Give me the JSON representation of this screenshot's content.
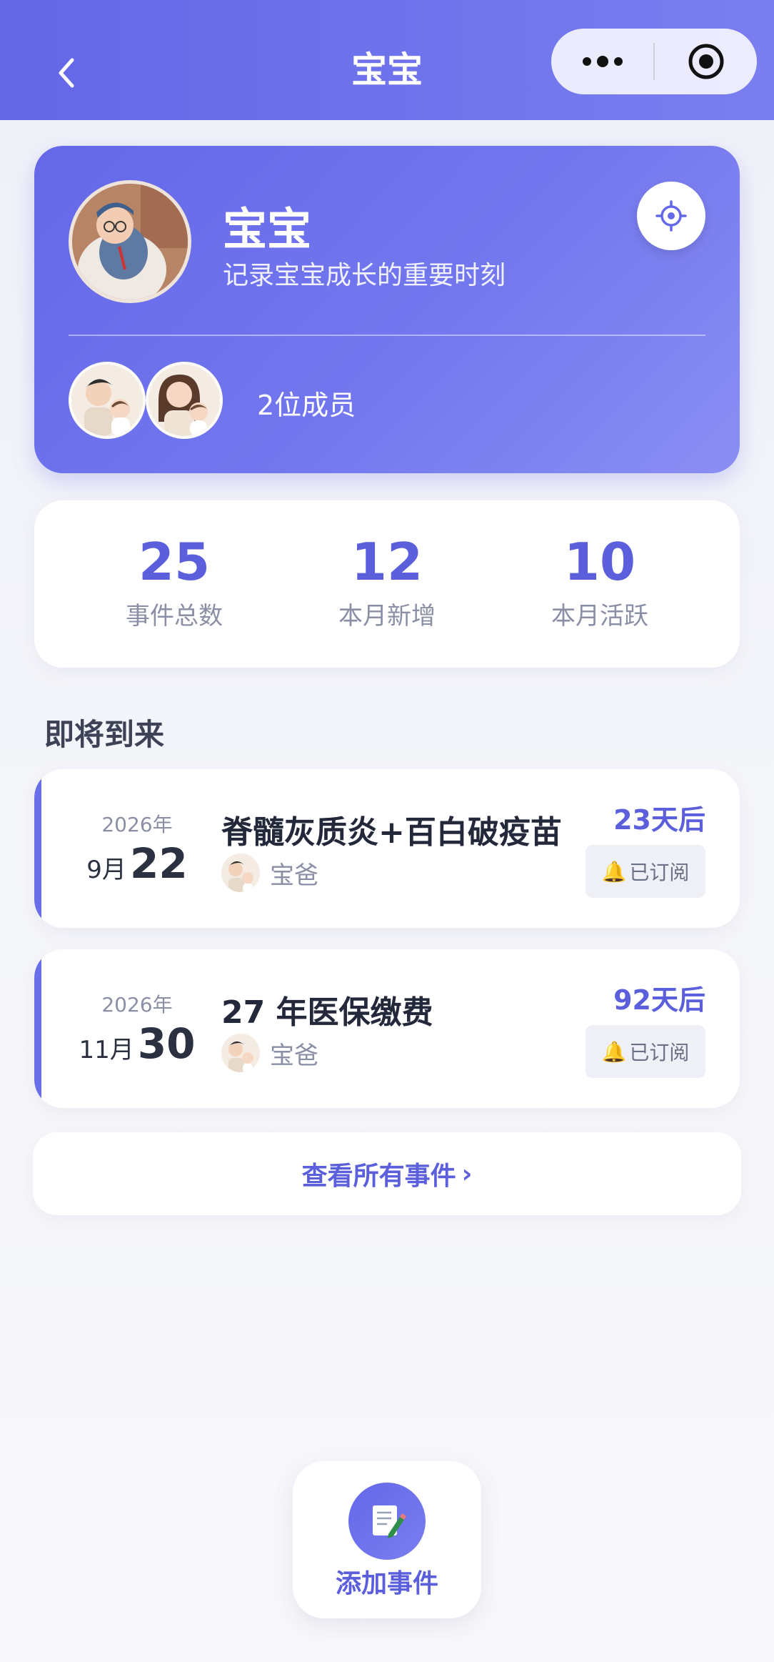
{
  "nav": {
    "title": "宝宝"
  },
  "profile": {
    "name": "宝宝",
    "description": "记录宝宝成长的重要时刻",
    "member_count": "2位成员"
  },
  "stats": [
    {
      "value": "25",
      "label": "事件总数"
    },
    {
      "value": "12",
      "label": "本月新增"
    },
    {
      "value": "10",
      "label": "本月活跃"
    }
  ],
  "upcoming": {
    "title": "即将到来",
    "events": [
      {
        "year": "2026年",
        "month": "9月",
        "day": "22",
        "title": "脊髓灰质炎+百白破疫苗",
        "owner": "宝爸",
        "days": "23天后",
        "subscribed": "已订阅"
      },
      {
        "year": "2026年",
        "month": "11月",
        "day": "30",
        "title": "27 年医保缴费",
        "owner": "宝爸",
        "days": "92天后",
        "subscribed": "已订阅"
      }
    ]
  },
  "view_all": {
    "label": "查看所有事件",
    "chevron": "›"
  },
  "add_event": {
    "label": "添加事件"
  },
  "colors": {
    "primary": "#6468e8",
    "accent_text": "#5b5fdc",
    "background": "#f4f5fa"
  }
}
